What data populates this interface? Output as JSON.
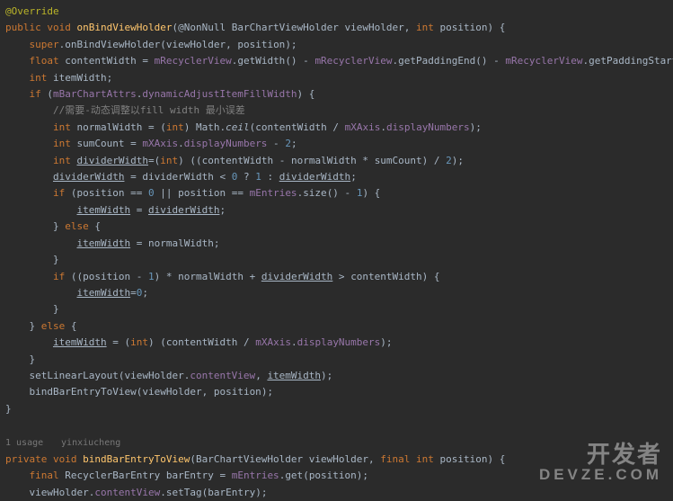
{
  "code": {
    "ann_override": "@Override",
    "kw_public": "public",
    "kw_void": "void",
    "kw_private": "private",
    "kw_final": "final",
    "kw_int": "int",
    "kw_float": "float",
    "kw_if": "if",
    "kw_else": "else",
    "kw_super": "super",
    "mth_onBind": "onBindViewHolder",
    "cls_annNonNull": "@NonNull",
    "cls_holder": "BarChartViewHolder",
    "param_viewHolder": "viewHolder",
    "param_position": "position",
    "var_contentWidth": "contentWidth",
    "field_mRecyclerView": "mRecyclerView",
    "mth_getWidth": "getWidth",
    "mth_getPaddingEnd": "getPaddingEnd",
    "mth_getPaddingStart": "getPaddingStart",
    "var_itemWidth": "itemWidth",
    "field_mBarChartAttrs": "mBarChartAttrs",
    "field_dynamicAdjust": "dynamicAdjustItemFillWidth",
    "comment_dyn": "//需要-动态调整以fill width 最小误差",
    "var_normalWidth": "normalWidth",
    "cls_Math": "Math",
    "mth_ceil": "ceil",
    "field_mXAxis": "mXAxis",
    "field_displayNumbers": "displayNumbers",
    "var_sumCount": "sumCount",
    "num_2": "2",
    "var_dividerWidth": "dividerWidth",
    "num_0": "0",
    "num_1": "1",
    "field_mEntries": "mEntries",
    "mth_size": "size",
    "mth_setLinearLayout": "setLinearLayout",
    "field_contentView": "contentView",
    "mth_bindBarEntryToView": "bindBarEntryToView",
    "hint_usage": "1 usage",
    "hint_author": "yinxiucheng",
    "cls_RecyclerBarEntry": "RecyclerBarEntry",
    "var_barEntry": "barEntry",
    "mth_get": "get",
    "mth_setTag": "setTag"
  },
  "watermark": {
    "line1": "开发者",
    "line2": "DEVZE.COM"
  }
}
